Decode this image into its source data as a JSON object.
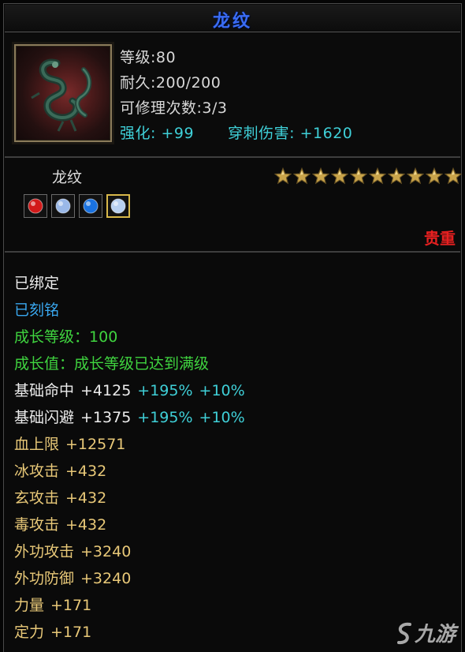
{
  "title": "龙纹",
  "item": {
    "level": "等级:80",
    "durability": "耐久:200/200",
    "repairs": "可修理次数:3/3",
    "enhance_label": "强化:",
    "enhance_value": "+99",
    "pierce_label": "穿刺伤害:",
    "pierce_value": "+1620"
  },
  "name": "龙纹",
  "stars": 10,
  "gems": [
    {
      "icon": "red-gem-icon",
      "color": "#d21a1a",
      "selected": false
    },
    {
      "icon": "white-crystal-icon",
      "color": "#9ab8e8",
      "selected": false
    },
    {
      "icon": "blue-gem-icon",
      "color": "#1a72e0",
      "selected": false
    },
    {
      "icon": "white-crystal-icon",
      "color": "#b8d0f0",
      "selected": true
    }
  ],
  "rarity": "贵重",
  "attributes": [
    {
      "label": "已绑定",
      "color": "w",
      "value": "",
      "extra1": "",
      "extra2": ""
    },
    {
      "label": "已刻铭",
      "color": "b",
      "value": "",
      "extra1": "",
      "extra2": ""
    },
    {
      "label": "成长等级：",
      "color": "g",
      "value": "100",
      "extra1": "",
      "extra2": ""
    },
    {
      "label": "成长值：成长等级已达到满级",
      "color": "g",
      "value": "",
      "extra1": "",
      "extra2": ""
    },
    {
      "label": "基础命中",
      "color": "w",
      "value": "+4125",
      "extra1": "+195%",
      "extra2": "+10%"
    },
    {
      "label": "基础闪避",
      "color": "w",
      "value": "+1375",
      "extra1": "+195%",
      "extra2": "+10%"
    },
    {
      "label": "血上限",
      "color": "y",
      "value": "+12571",
      "extra1": "",
      "extra2": ""
    },
    {
      "label": "冰攻击",
      "color": "y",
      "value": "+432",
      "extra1": "",
      "extra2": ""
    },
    {
      "label": "玄攻击",
      "color": "y",
      "value": "+432",
      "extra1": "",
      "extra2": ""
    },
    {
      "label": "毒攻击",
      "color": "y",
      "value": "+432",
      "extra1": "",
      "extra2": ""
    },
    {
      "label": "外功攻击",
      "color": "y",
      "value": "+3240",
      "extra1": "",
      "extra2": ""
    },
    {
      "label": "外功防御",
      "color": "y",
      "value": "+3240",
      "extra1": "",
      "extra2": ""
    },
    {
      "label": "力量",
      "color": "y",
      "value": "+171",
      "extra1": "",
      "extra2": ""
    },
    {
      "label": "定力",
      "color": "y",
      "value": "+171",
      "extra1": "",
      "extra2": ""
    }
  ],
  "watermark": "九游"
}
